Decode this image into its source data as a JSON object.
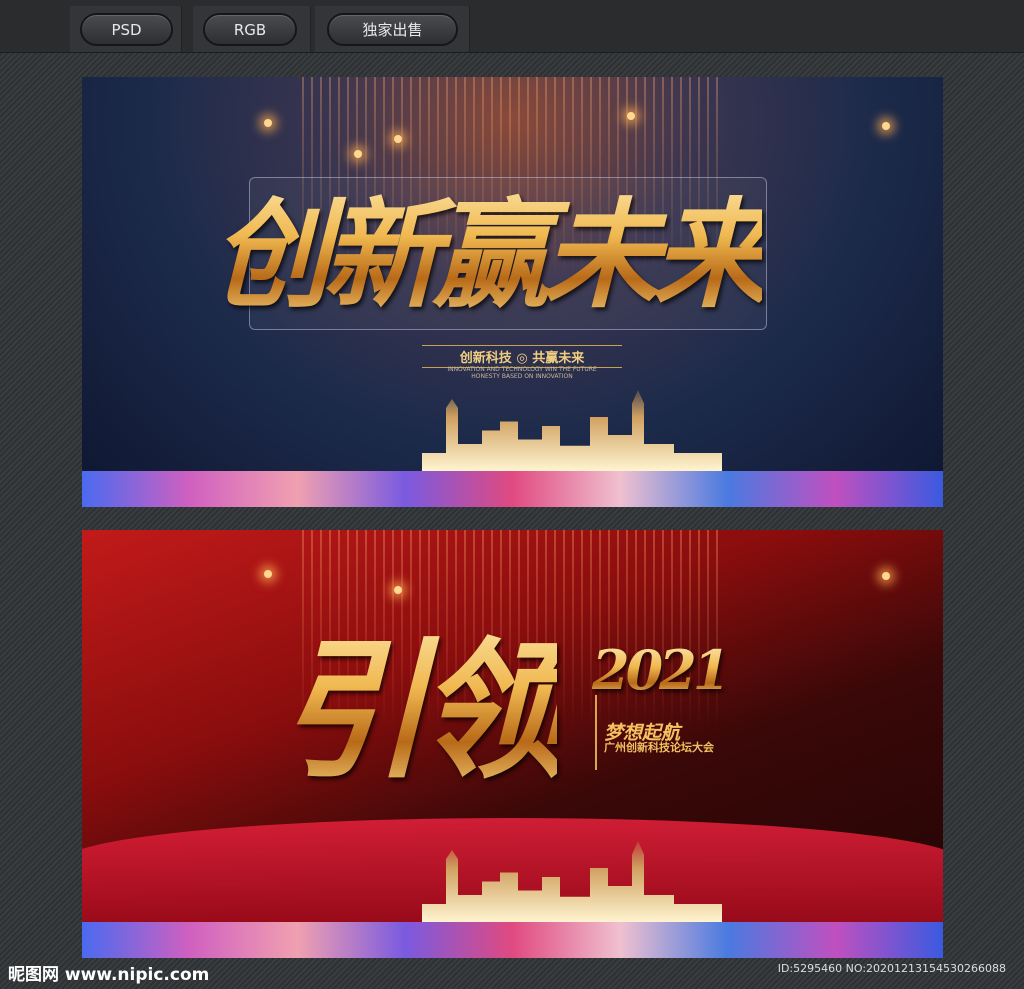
{
  "toolbar": {
    "buttons": [
      "PSD",
      "RGB",
      "独家出售"
    ]
  },
  "banner1": {
    "title": "创新赢未来",
    "subtitle": "创新科技 ◎ 共赢未来",
    "english_line1": "INNOVATION AND TECHNOLOGY WIN THE FUTURE",
    "english_line2": "HONESTY BASED ON INNOVATION"
  },
  "banner2": {
    "title": "引领",
    "year": "2021",
    "slogan": "梦想起航",
    "event": "广州创新科技论坛大会"
  },
  "footer": {
    "logo": "昵图网 www.nipic.com",
    "id": "ID:5295460 NO:20201213154530266088"
  }
}
